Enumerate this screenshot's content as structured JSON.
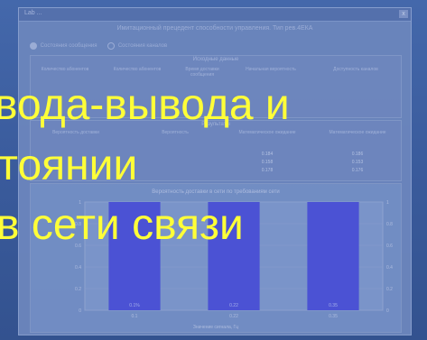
{
  "window": {
    "title": "Lab ...",
    "close_label": "x",
    "header": "Имитационный прецедент способности управления. Тип рев.4ЕКА"
  },
  "mode_selector": {
    "options": [
      {
        "label": "Состояния сообщения",
        "selected": true
      },
      {
        "label": "Состояния каналов",
        "selected": false
      }
    ]
  },
  "table1": {
    "title": "Исходные данные",
    "headers": [
      "Количество абонентов",
      "Количество абонентов",
      "Время доставки сообщения",
      "Начальная вероятность",
      "Доступность каналов"
    ],
    "rows": [
      [
        "",
        "",
        "",
        "",
        ""
      ]
    ]
  },
  "table2": {
    "title": "Результаты",
    "headers": [
      "Вероятность доставки",
      "Вероятность",
      "Математическое ожидание",
      "Математическое ожидание"
    ],
    "rows": [
      [
        "",
        "",
        "0.184",
        "0.186"
      ],
      [
        "",
        "",
        "0.158",
        "0.153"
      ],
      [
        "",
        "",
        "0.178",
        "0.176"
      ]
    ]
  },
  "chart_data": {
    "type": "bar",
    "title": "Вероятность доставки в сети по требованиям сети",
    "xlabel": "Значение сигнала, Гц",
    "categories": [
      "0.1",
      "0.22",
      "0.35"
    ],
    "values": [
      1.0,
      1.0,
      1.0
    ],
    "bar_labels": [
      "0.1%",
      "0.22",
      "0.35"
    ],
    "ylim": [
      0,
      1.0
    ],
    "yticks": [
      "1",
      "0.8",
      "0.6",
      "0.4",
      "0.2",
      "0"
    ],
    "bar_color": "#4d52d8"
  },
  "overlay": {
    "line1": "вода-вывода и",
    "line2": "тоянии",
    "line3": "в сети связи",
    "color": "#ffff38"
  }
}
